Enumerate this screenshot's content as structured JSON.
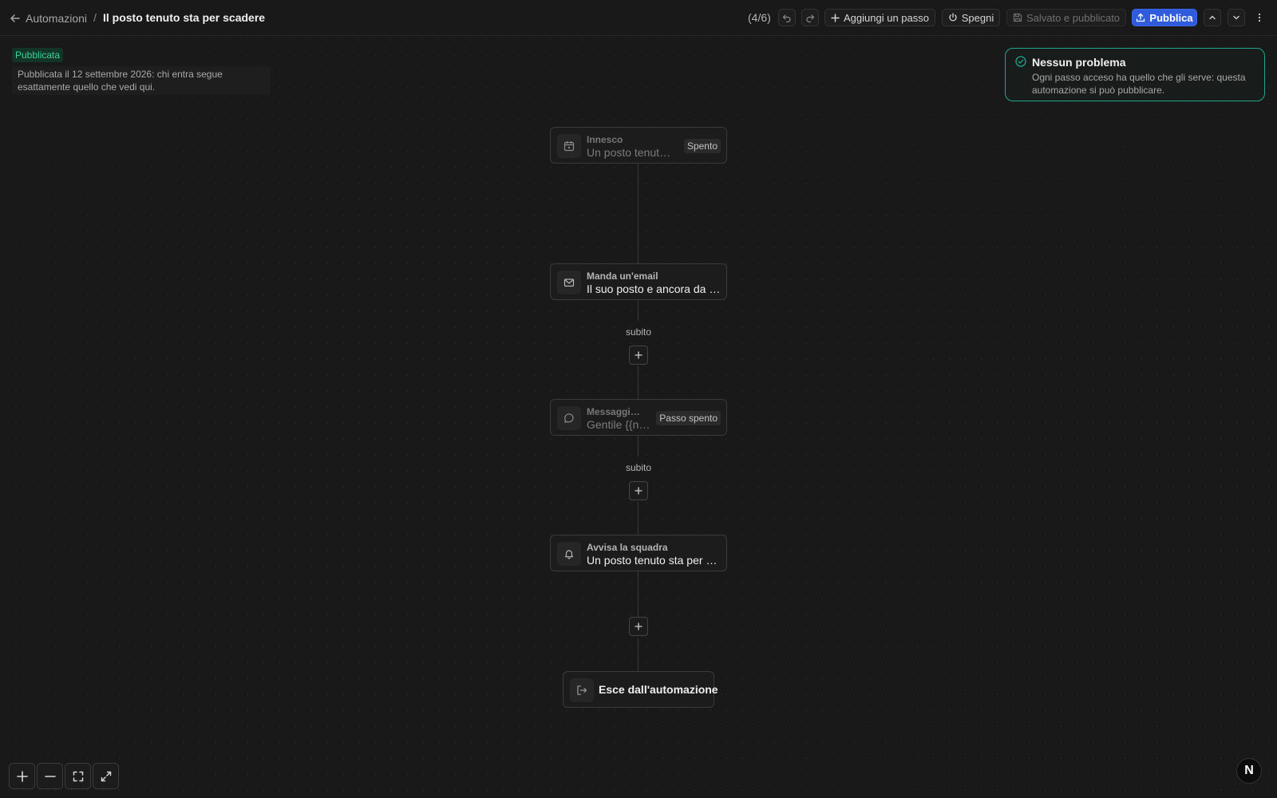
{
  "header": {
    "back_label": "Automazioni",
    "separator": "/",
    "title": "Il posto tenuto sta per scadere",
    "counter": "(4/6)",
    "add_step_label": "Aggiungi un passo",
    "turn_off_label": "Spegni",
    "saved_label": "Salvato e pubblicato",
    "publish_label": "Pubblica"
  },
  "status": {
    "badge": "Pubblicata",
    "note": "Pubblicata il 12 settembre 2026: chi entra segue esattamente quello che vedi qui."
  },
  "validation": {
    "title": "Nessun problema",
    "body": "Ogni passo acceso ha quello che gli serve: questa automazione si può pubblicare."
  },
  "flow": {
    "trigger": {
      "label": "Innesco",
      "value": "Un posto tenuto sta per scadere",
      "tag": "Spento",
      "icon": "calendar-icon"
    },
    "steps": [
      {
        "label": "Manda un'email",
        "value": "Il suo posto e ancora da confermare",
        "icon": "mail-icon",
        "delay": "subito"
      },
      {
        "label": "Messaggio di testo",
        "value": "Gentile {{nome}}",
        "tag": "Passo spento",
        "icon": "chat-icon",
        "delay": "subito"
      },
      {
        "label": "Avvisa la squadra",
        "value": "Un posto tenuto sta per scadere",
        "icon": "bell-icon"
      }
    ],
    "exit": {
      "label": "Esce dall'automazione",
      "icon": "exit-icon"
    }
  },
  "brand": {
    "mark": "N"
  },
  "colors": {
    "background": "#191919",
    "accent": "#2f5bdc",
    "success": "#1fa58d",
    "published_badge": "#3fd19a"
  }
}
